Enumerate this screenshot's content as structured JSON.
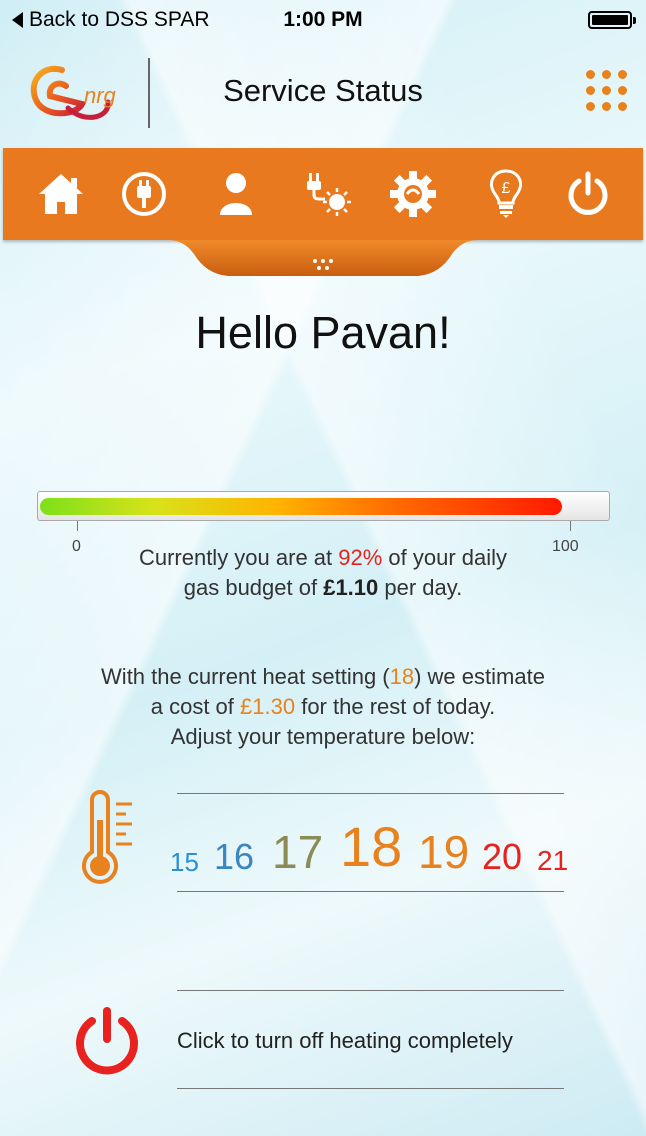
{
  "status_bar": {
    "back_label": "Back to DSS SPAR",
    "time": "1:00 PM"
  },
  "header": {
    "logo_text": "nrg",
    "title": "Service Status"
  },
  "nav": [
    {
      "name": "home-icon"
    },
    {
      "name": "plug-icon"
    },
    {
      "name": "user-icon"
    },
    {
      "name": "solar-plug-icon"
    },
    {
      "name": "gear-icon"
    },
    {
      "name": "lightbulb-pound-icon"
    },
    {
      "name": "power-icon"
    }
  ],
  "greeting": "Hello Pavan!",
  "budget": {
    "percent": 92,
    "min_label": "0",
    "max_label": "100",
    "line1_a": "Currently you are at ",
    "line1_pct": "92%",
    "line1_b": " of your daily",
    "line2_a": "gas budget of ",
    "line2_amount": "£1.10",
    "line2_b": " per day."
  },
  "estimate": {
    "line1_a": "With the current heat setting (",
    "line1_setting": "18",
    "line1_b": ") we estimate",
    "line2_a": "a cost of ",
    "line2_cost": "£1.30",
    "line2_b": " for the rest of today.",
    "line3": "Adjust your temperature below:"
  },
  "temperatures": [
    {
      "label": "15",
      "color": "#2a8fd6"
    },
    {
      "label": "16",
      "color": "#3a86c0"
    },
    {
      "label": "17",
      "color": "#8c8a55"
    },
    {
      "label": "18",
      "color": "#e8821e"
    },
    {
      "label": "19",
      "color": "#e8821e"
    },
    {
      "label": "20",
      "color": "#e8221e"
    },
    {
      "label": "21",
      "color": "#e8221e"
    }
  ],
  "selected_temperature": "18",
  "heating_off_label": "Click to turn off heating completely",
  "colors": {
    "accent": "#e8791e",
    "alert": "#e8221e"
  }
}
